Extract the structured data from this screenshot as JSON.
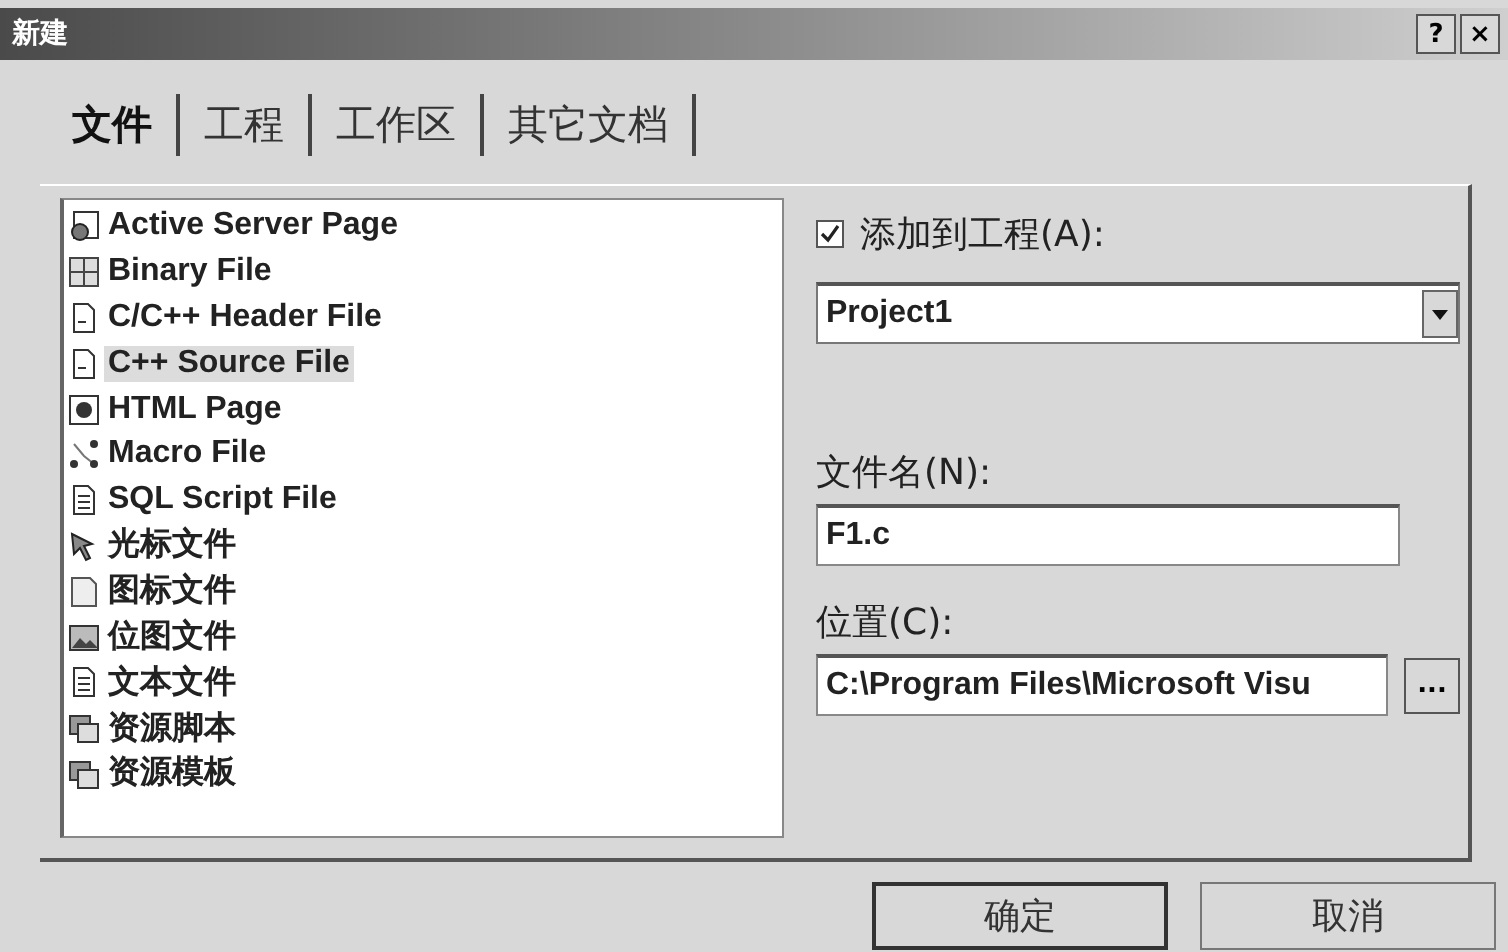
{
  "window": {
    "title": "新建",
    "help_button": "?",
    "close_button": "×"
  },
  "tabs": [
    {
      "label": "文件",
      "selected": true
    },
    {
      "label": "工程",
      "selected": false
    },
    {
      "label": "工作区",
      "selected": false
    },
    {
      "label": "其它文档",
      "selected": false
    }
  ],
  "file_types": [
    {
      "label": "Active Server Page",
      "kind": "web",
      "selected": false
    },
    {
      "label": "Binary File",
      "kind": "grid",
      "selected": false
    },
    {
      "label": "C/C++ Header File",
      "kind": "doc",
      "selected": false
    },
    {
      "label": "C++ Source File",
      "kind": "doc",
      "selected": true
    },
    {
      "label": "HTML Page",
      "kind": "globe",
      "selected": false
    },
    {
      "label": "Macro File",
      "kind": "nodes",
      "selected": false
    },
    {
      "label": "SQL Script File",
      "kind": "text",
      "selected": false
    },
    {
      "label": "光标文件",
      "kind": "cursor",
      "selected": false
    },
    {
      "label": "图标文件",
      "kind": "page",
      "selected": false
    },
    {
      "label": "位图文件",
      "kind": "image",
      "selected": false
    },
    {
      "label": "文本文件",
      "kind": "text",
      "selected": false
    },
    {
      "label": "资源脚本",
      "kind": "stack",
      "selected": false
    },
    {
      "label": "资源模板",
      "kind": "stack",
      "selected": false
    }
  ],
  "add_to_project": {
    "label": "添加到工程(A):",
    "checked": true
  },
  "project": {
    "value": "Project1"
  },
  "file_name": {
    "label": "文件名(N):",
    "value": "F1.c"
  },
  "location": {
    "label": "位置(C):",
    "value": "C:\\Program Files\\Microsoft Visu",
    "browse": "..."
  },
  "buttons": [
    {
      "label": "确定",
      "default": true
    },
    {
      "label": "取消",
      "default": false
    }
  ]
}
